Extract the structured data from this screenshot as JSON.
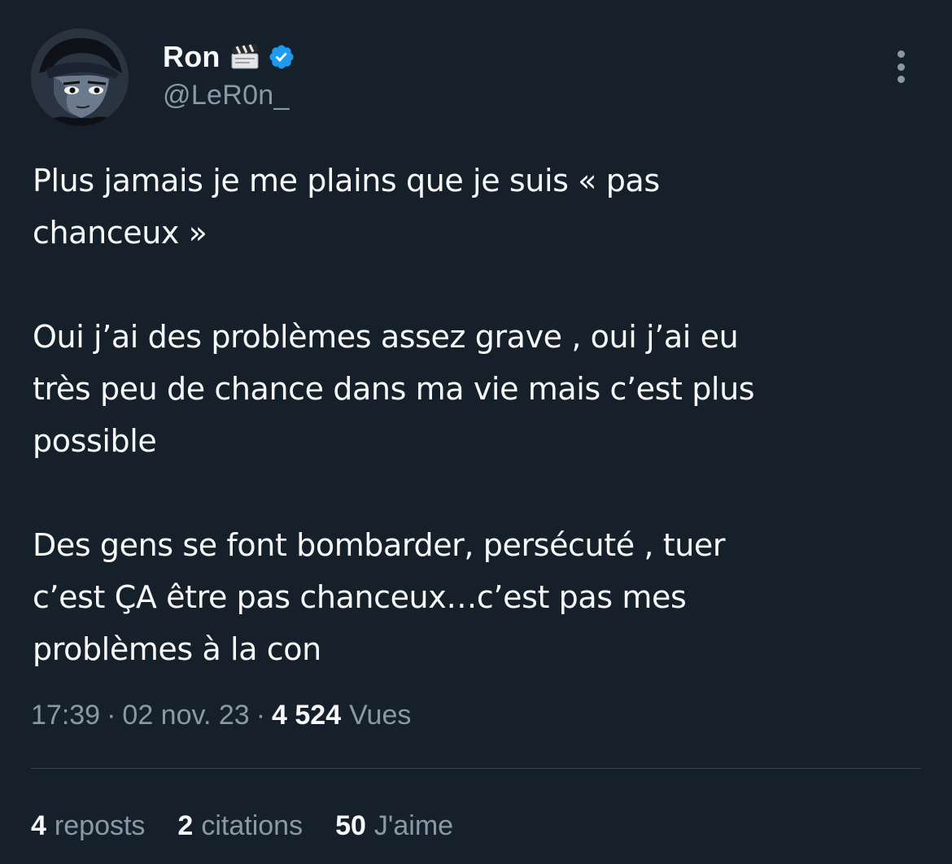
{
  "tweet": {
    "author": {
      "display_name": "Ron",
      "handle": "@LeR0n_",
      "emoji_icon": "clapper-board-icon",
      "verified_icon": "verified-badge-icon",
      "verified_color": "#1d9bf0"
    },
    "paragraphs": [
      "Plus jamais je me plains que je suis « pas\nchanceux »",
      "Oui j’ai des problèmes assez grave , oui j’ai eu\ntrès peu de chance dans ma vie mais c’est plus\npossible",
      "Des gens se font bombarder, persécuté , tuer\nc’est ÇA être pas chanceux…c’est pas mes\nproblèmes à la con"
    ],
    "meta": {
      "time": "17:39",
      "separator": "·",
      "date": "02 nov. 23",
      "views_count": "4 524",
      "views_label": "Vues"
    },
    "stats": {
      "reposts_count": "4",
      "reposts_label": "reposts",
      "citations_count": "2",
      "citations_label": "citations",
      "likes_count": "50",
      "likes_label": "J'aime"
    }
  },
  "colors": {
    "background": "#15202b",
    "text_primary": "#f7f9f9",
    "text_secondary": "#8b98a5",
    "divider": "#38444d",
    "accent": "#1d9bf0"
  }
}
